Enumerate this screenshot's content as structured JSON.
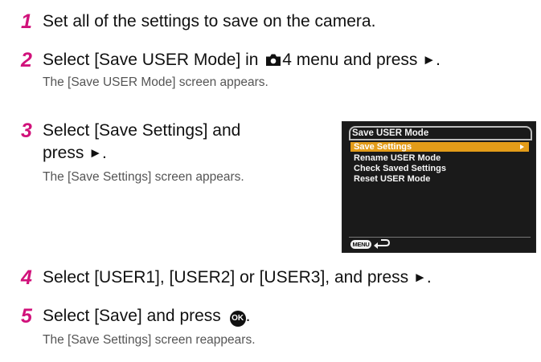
{
  "steps": [
    {
      "number": "1",
      "title": "Set all of the settings to save on the camera."
    },
    {
      "number": "2",
      "title_before": "Select [Save USER Mode] in ",
      "title_after": "4 menu and press ",
      "arrow": "►",
      "title_end": ".",
      "desc": "The [Save USER Mode] screen appears.",
      "menu_icon": "camera-icon"
    },
    {
      "number": "3",
      "title_line1": "Select [Save Settings] and",
      "title_line2": "press ",
      "arrow": "►",
      "title_end": ".",
      "desc": "The [Save Settings] screen appears."
    },
    {
      "number": "4",
      "title": "Select [USER1], [USER2] or [USER3], and press ",
      "arrow": "►",
      "title_end": "."
    },
    {
      "number": "5",
      "title": "Select [Save] and press ",
      "ok_label": "OK",
      "title_end": ".",
      "desc": "The [Save Settings] screen reappears."
    }
  ],
  "camera_screen": {
    "tab_title": "Save USER Mode",
    "items": [
      {
        "label": "Save Settings",
        "selected": true,
        "has_submenu": true
      },
      {
        "label": "Rename USER Mode",
        "selected": false
      },
      {
        "label": "Check Saved Settings",
        "selected": false
      },
      {
        "label": "Reset USER Mode",
        "selected": false
      }
    ],
    "menu_button_label": "MENU",
    "back_icon": "return-arrow-icon",
    "highlight_color": "#e39c19"
  },
  "colors": {
    "step_number": "#d1127b",
    "description": "#555555"
  }
}
